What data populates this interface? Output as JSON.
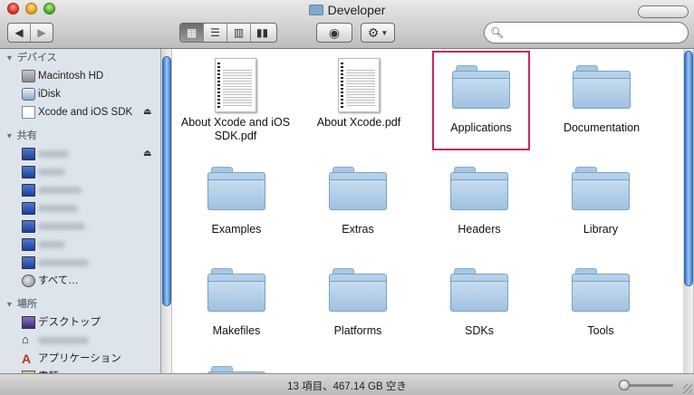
{
  "window": {
    "title": "Developer"
  },
  "toolbar": {
    "back_icon": "back-arrow-icon",
    "forward_icon": "forward-arrow-icon",
    "view_modes": [
      "icon-view",
      "list-view",
      "column-view",
      "coverflow-view"
    ],
    "active_view": "icon-view",
    "quicklook_icon": "eye-icon",
    "action_icon": "gear-icon",
    "search": {
      "value": "",
      "placeholder": ""
    }
  },
  "sidebar": {
    "devices": {
      "header": "デバイス",
      "items": [
        {
          "label": "Macintosh HD",
          "icon": "hard-disk-icon"
        },
        {
          "label": "iDisk",
          "icon": "idisk-icon"
        },
        {
          "label": "Xcode and iOS SDK",
          "icon": "disk-image-icon",
          "eject": true
        }
      ]
    },
    "shared": {
      "header": "共有",
      "items": [
        {
          "icon": "computer-icon"
        },
        {
          "icon": "computer-icon"
        },
        {
          "icon": "computer-icon"
        },
        {
          "icon": "computer-icon"
        },
        {
          "icon": "computer-icon"
        },
        {
          "icon": "computer-icon"
        },
        {
          "icon": "computer-icon"
        },
        {
          "label": "すべて…",
          "icon": "network-globe-icon"
        }
      ]
    },
    "places": {
      "header": "場所",
      "items": [
        {
          "label": "デスクトップ",
          "icon": "desktop-icon"
        },
        {
          "icon": "home-icon"
        },
        {
          "label": "アプリケーション",
          "icon": "applications-icon"
        },
        {
          "label": "書類",
          "icon": "documents-icon"
        }
      ]
    }
  },
  "files": [
    {
      "name": "About Xcode and iOS SDK.pdf",
      "kind": "pdf"
    },
    {
      "name": "About Xcode.pdf",
      "kind": "pdf"
    },
    {
      "name": "Applications",
      "kind": "folder",
      "selected": true
    },
    {
      "name": "Documentation",
      "kind": "folder"
    },
    {
      "name": "Examples",
      "kind": "folder"
    },
    {
      "name": "Extras",
      "kind": "folder"
    },
    {
      "name": "Headers",
      "kind": "folder"
    },
    {
      "name": "Library",
      "kind": "folder"
    },
    {
      "name": "Makefiles",
      "kind": "folder"
    },
    {
      "name": "Platforms",
      "kind": "folder"
    },
    {
      "name": "SDKs",
      "kind": "folder"
    },
    {
      "name": "Tools",
      "kind": "folder"
    },
    {
      "name": "",
      "kind": "folder"
    }
  ],
  "status": {
    "text": "13 項目、467.14 GB 空き"
  },
  "colors": {
    "selection_outline": "#c8275b",
    "folder_blue": "#9fc2e0",
    "sidebar_bg": "#dde4eb",
    "scroll_thumb": "#3e7fd2"
  }
}
